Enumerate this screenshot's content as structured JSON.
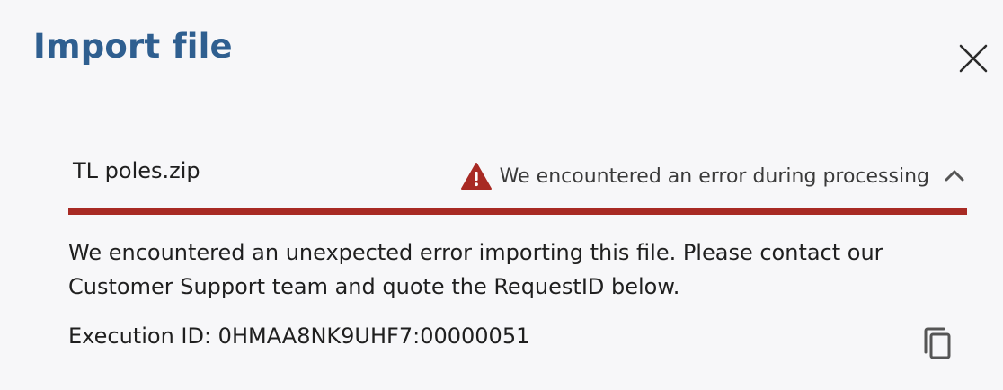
{
  "dialog": {
    "title": "Import file"
  },
  "file": {
    "name": "TL poles.zip",
    "status_text": "We encountered an error during processing"
  },
  "error": {
    "message": "We encountered an unexpected error importing this file. Please contact our Customer Support team and quote the RequestID below.",
    "execution_id": "Execution ID: 0HMAA8NK9UHF7:00000051"
  },
  "icons": {
    "close": "close-icon",
    "warning": "warning-icon",
    "collapse": "chevron-up-icon",
    "copy": "copy-icon"
  },
  "colors": {
    "title": "#2f5f90",
    "error": "#a82a24",
    "background": "#f7f7f9"
  }
}
